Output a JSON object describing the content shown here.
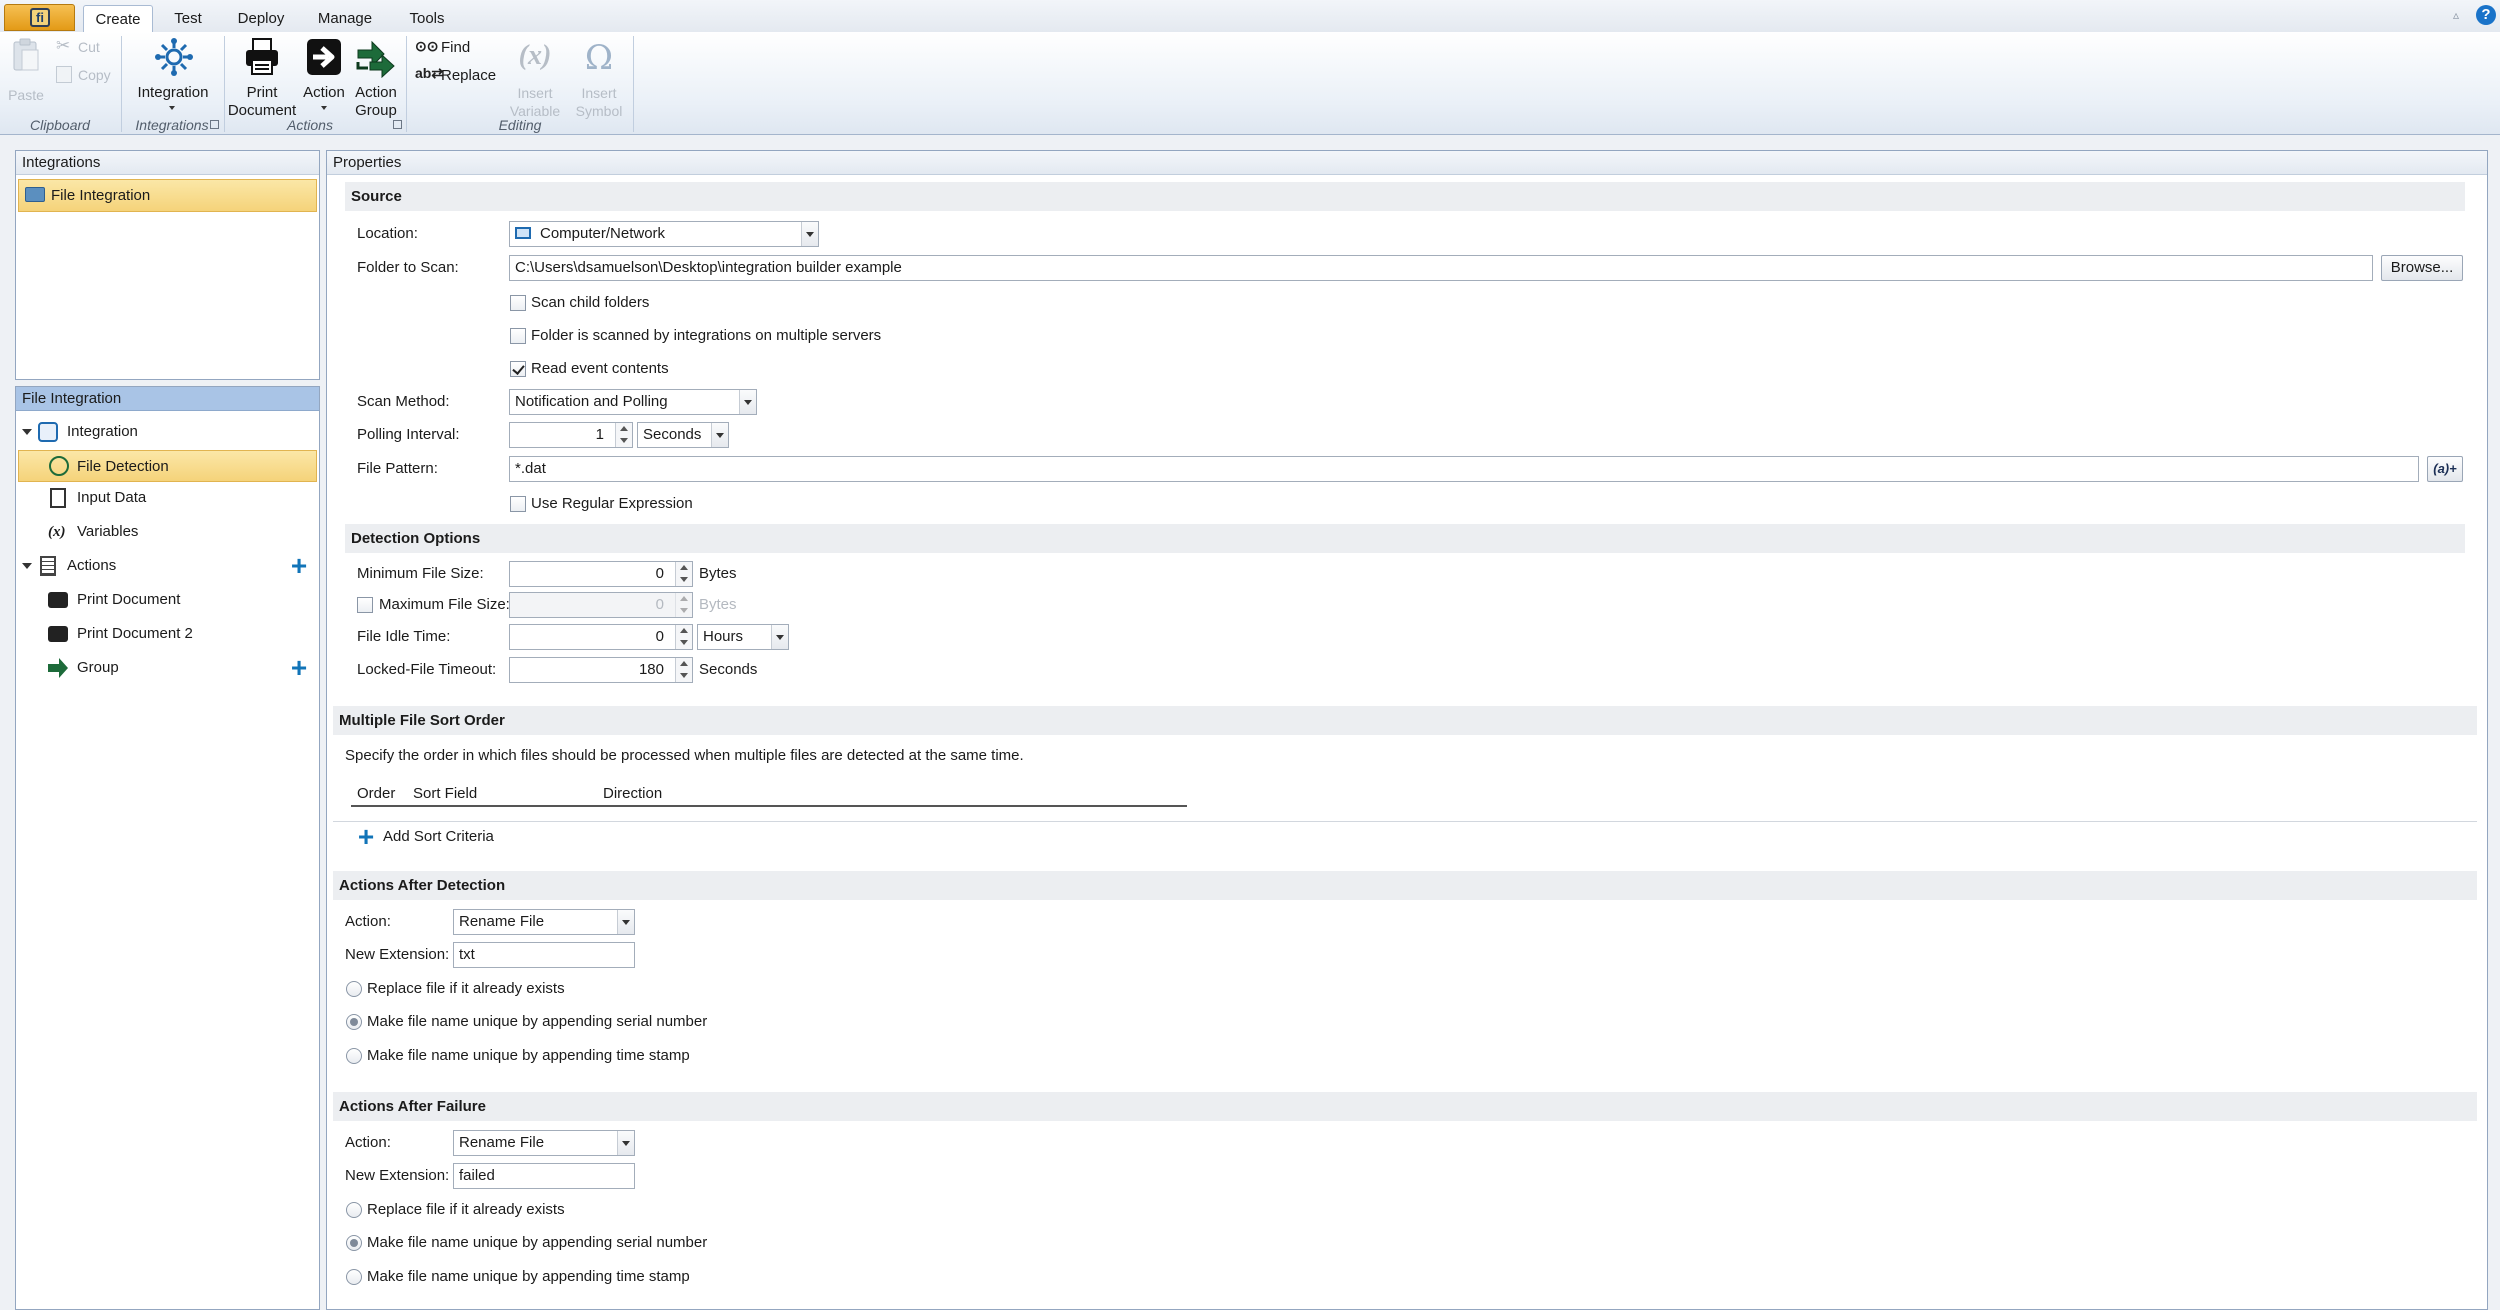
{
  "ribbon": {
    "tabs": [
      "Create",
      "Test",
      "Deploy",
      "Manage",
      "Tools"
    ],
    "active_tab": "Create",
    "clipboard": {
      "paste": "Paste",
      "cut": "Cut",
      "copy": "Copy",
      "group": "Clipboard"
    },
    "integrations": {
      "integration": "Integration",
      "group": "Integrations"
    },
    "actions": {
      "print_line1": "Print",
      "print_line2": "Document",
      "action": "Action",
      "action_group_line1": "Action",
      "action_group_line2": "Group",
      "group": "Actions"
    },
    "editing": {
      "find": "Find",
      "replace": "Replace",
      "insert_variable_line1": "Insert",
      "insert_variable_line2": "Variable",
      "insert_symbol_line1": "Insert",
      "insert_symbol_line2": "Symbol",
      "group": "Editing"
    }
  },
  "integrations_panel": {
    "title": "Integrations",
    "items": [
      "File Integration"
    ]
  },
  "tree_panel": {
    "title": "File Integration",
    "nodes": {
      "integration": "Integration",
      "file_detection": "File Detection",
      "input_data": "Input Data",
      "variables": "Variables",
      "actions": "Actions",
      "print_document": "Print Document",
      "print_document_2": "Print Document 2",
      "group": "Group"
    }
  },
  "properties": {
    "title": "Properties",
    "source": {
      "header": "Source",
      "location_label": "Location:",
      "location_value": "Computer/Network",
      "folder_label": "Folder to Scan:",
      "folder_value": "C:\\Users\\dsamuelson\\Desktop\\integration builder example",
      "browse": "Browse...",
      "scan_child": "Scan child folders",
      "multi_server": "Folder is scanned by integrations on multiple servers",
      "read_event": "Read event contents",
      "scan_method_label": "Scan Method:",
      "scan_method_value": "Notification and Polling",
      "polling_label": "Polling Interval:",
      "polling_value": "1",
      "polling_unit": "Seconds",
      "pattern_label": "File Pattern:",
      "pattern_value": "*.dat",
      "pattern_btn": "(a)+",
      "use_regex": "Use Regular Expression"
    },
    "detection": {
      "header": "Detection Options",
      "min_label": "Minimum File Size:",
      "min_value": "0",
      "min_unit": "Bytes",
      "max_label": "Maximum File Size:",
      "max_value": "0",
      "max_unit": "Bytes",
      "idle_label": "File Idle Time:",
      "idle_value": "0",
      "idle_unit": "Hours",
      "locked_label": "Locked-File Timeout:",
      "locked_value": "180",
      "locked_unit": "Seconds"
    },
    "sort": {
      "header": "Multiple File Sort Order",
      "description": "Specify the order in which files should be processed when multiple files are detected at the same time.",
      "columns": [
        "Order",
        "Sort Field",
        "Direction"
      ],
      "add": "Add Sort Criteria"
    },
    "after_detection": {
      "header": "Actions After Detection",
      "action_label": "Action:",
      "action_value": "Rename File",
      "ext_label": "New Extension:",
      "ext_value": "txt",
      "opt_replace": "Replace file if it already exists",
      "opt_serial": "Make file name unique by appending serial number",
      "opt_time": "Make file name unique by appending time stamp"
    },
    "after_failure": {
      "header": "Actions After Failure",
      "action_label": "Action:",
      "action_value": "Rename File",
      "ext_label": "New Extension:",
      "ext_value": "failed",
      "opt_replace": "Replace file if it already exists",
      "opt_serial": "Make file name unique by appending serial number",
      "opt_time": "Make file name unique by appending time stamp"
    }
  },
  "colors": {
    "accent": "#f5d37a",
    "brand": "#e39a16",
    "tree_header": "#a9c4e6",
    "icon_green": "#1d6b3a",
    "plus_blue": "#1174b8"
  }
}
